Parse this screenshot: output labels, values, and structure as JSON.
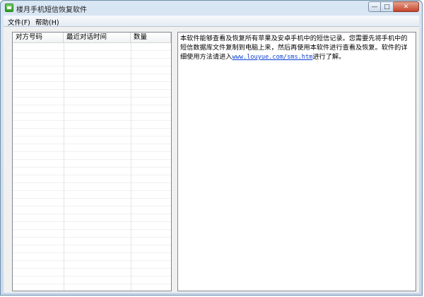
{
  "window": {
    "title": "楼月手机短信恢复软件",
    "minimize_glyph": "—",
    "maximize_glyph": "□",
    "close_glyph": "✕",
    "icon": "sms-app-icon"
  },
  "menu": {
    "items": [
      {
        "label": "文件(F)"
      },
      {
        "label": "帮助(H)"
      }
    ]
  },
  "list": {
    "columns": [
      {
        "label": "对方号码"
      },
      {
        "label": "最近对话时间"
      },
      {
        "label": "数量"
      }
    ],
    "rows": []
  },
  "description": {
    "text_before_link": "本软件能够查看及恢复所有苹果及安卓手机中的短信记录。您需要先将手机中的短信数据库文件复制到电脑上来，然后再使用本软件进行查看及恢复。软件的详细使用方法请进入",
    "link_text": "www.louyue.com/sms.htm",
    "text_after_link": "进行了解。"
  }
}
